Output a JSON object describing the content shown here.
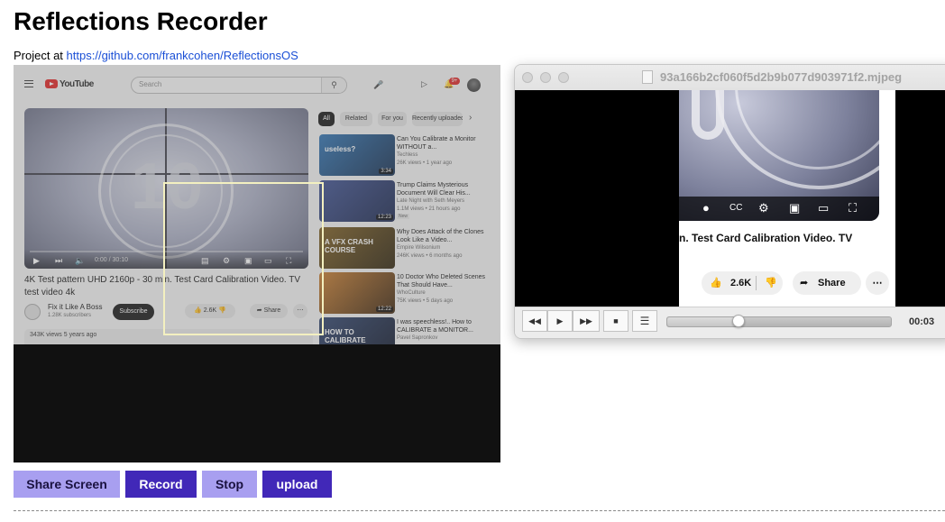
{
  "app": {
    "title": "Reflections Recorder",
    "project_prefix": "Project at",
    "project_url": "https://github.com/frankcohen/ReflectionsOS"
  },
  "youtube": {
    "logo_text": "YouTube",
    "search_placeholder": "Search",
    "notification_count": "9+",
    "player_time": "0:00 / 30:10",
    "video_title": "4K Test pattern UHD 2160p - 30 min. Test Card Calibration Video. TV test video 4k",
    "channel_name": "Fix it Like A Boss",
    "channel_subs": "1.28K subscribers",
    "subscribe_label": "Subscribe",
    "likes": "2.6K",
    "share_label": "Share",
    "more_label": "⋯",
    "desc_views": "343K views  5 years ago",
    "chips": [
      "All",
      "Related",
      "For you",
      "Recently uploaded"
    ],
    "recommendations": [
      {
        "title": "Can You Calibrate a Monitor WITHOUT a...",
        "channel": "Techless",
        "meta": "26K views • 1 year ago",
        "duration": "3:34",
        "thumb_color": "#2a6fb0",
        "thumb_color2": "#0f2a4d",
        "badge": ""
      },
      {
        "title": "Trump Claims Mysterious Document Will Clear His...",
        "channel": "Late Night with Seth Meyers",
        "meta": "1.1M views • 21 hours ago",
        "duration": "12:23",
        "thumb_color": "#3a4d8f",
        "thumb_color2": "#15224a",
        "badge": "New"
      },
      {
        "title": "Why Does Attack of the Clones Look Like a Video...",
        "channel": "Empire Wilsonium",
        "meta": "246K views • 6 months ago",
        "duration": "",
        "thumb_color": "#7a5a1c",
        "thumb_color2": "#2a1f08",
        "badge": ""
      },
      {
        "title": "10 Doctor Who Deleted Scenes That Should Have...",
        "channel": "WhoCulture",
        "meta": "75K views • 5 days ago",
        "duration": "12:22",
        "thumb_color": "#c77a2a",
        "thumb_color2": "#3a220a",
        "badge": ""
      },
      {
        "title": "I was speechless!.. How to CALIBRATE a MONITOR...",
        "channel": "Pavel Sapronkov",
        "meta": "",
        "duration": "",
        "thumb_color": "#2a3f6a",
        "thumb_color2": "#0a1226",
        "badge": ""
      }
    ],
    "rec_thumb_texts": [
      "useless?",
      "",
      "A VFX CRASH COURSE",
      "",
      "HOW TO CALIBRATE"
    ]
  },
  "player_window": {
    "title": "93a166b2cf060f5d2b9b077d903971f2.mjpeg",
    "zoom_title": "n. Test Card Calibration Video. TV",
    "likes": "2.6K",
    "share_label": "Share",
    "more_label": "⋯",
    "time": "00:03",
    "progress_fraction": 0.32
  },
  "buttons": {
    "share_screen": "Share Screen",
    "record": "Record",
    "stop": "Stop",
    "upload": "upload"
  },
  "colors": {
    "button_light": "#a89ff0",
    "button_dark": "#4128b8",
    "link": "#1a4fd6",
    "selection": "#f3f0c0"
  }
}
